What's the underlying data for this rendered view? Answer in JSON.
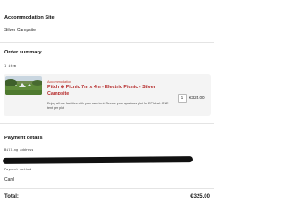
{
  "accommodation": {
    "heading": "Accommodation Site",
    "site_name": "Silver Campsite"
  },
  "order_summary": {
    "heading": "Order summary",
    "item_count": "1 item",
    "item": {
      "badge": "Accommodation",
      "title": "Pitch ⊕ Picnic 7m x 4m - Electric Picnic - Silver Campsite",
      "description": "Enjoy all our facilities with your own tent. Secure your spacious plot for EPIdeal. ONE tent per plot",
      "quantity": "1",
      "price": "€325.00",
      "image_icon": "campsite-photo"
    }
  },
  "payment": {
    "heading": "Payment details",
    "billing_label": "Billing address",
    "method_label": "Payment method",
    "method_value": "Card"
  },
  "total": {
    "label": "Total:",
    "value": "€325.00"
  },
  "colors": {
    "accent": "#b52b2b",
    "card_bg": "#f4f4f4",
    "divider": "#e4e4e4"
  }
}
